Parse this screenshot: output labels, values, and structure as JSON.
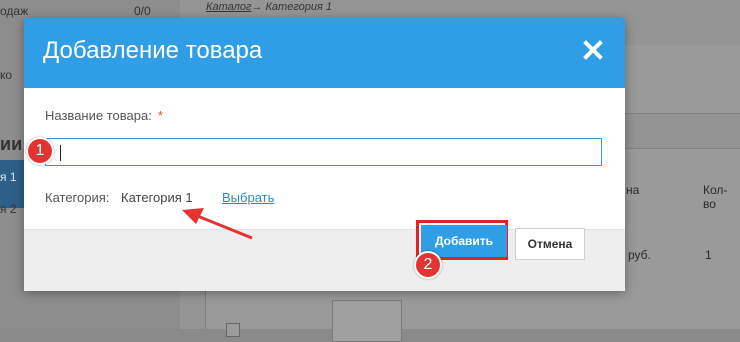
{
  "background": {
    "left_rows": [
      "одаж",
      "0/0",
      "ко",
      "ии",
      "я 1",
      "я 2"
    ],
    "breadcrumb_link": "Каталог",
    "breadcrumb_rest": "→ Категория 1",
    "col_na": "на",
    "col_qty": "Кол-во",
    "cell_price": "руб.",
    "cell_qty": "1"
  },
  "modal": {
    "title": "Добавление товара",
    "name_label": "Название товара:",
    "required_mark": "*",
    "name_value": "",
    "category_label": "Категория:",
    "category_value": "Категория 1",
    "choose_link": "Выбрать",
    "add_button": "Добавить",
    "cancel_button": "Отмена"
  },
  "annotations": {
    "step1": "1",
    "step2": "2"
  },
  "colors": {
    "header": "#2f9ee6",
    "accent_red": "#e53232",
    "link": "#2f86c8"
  }
}
